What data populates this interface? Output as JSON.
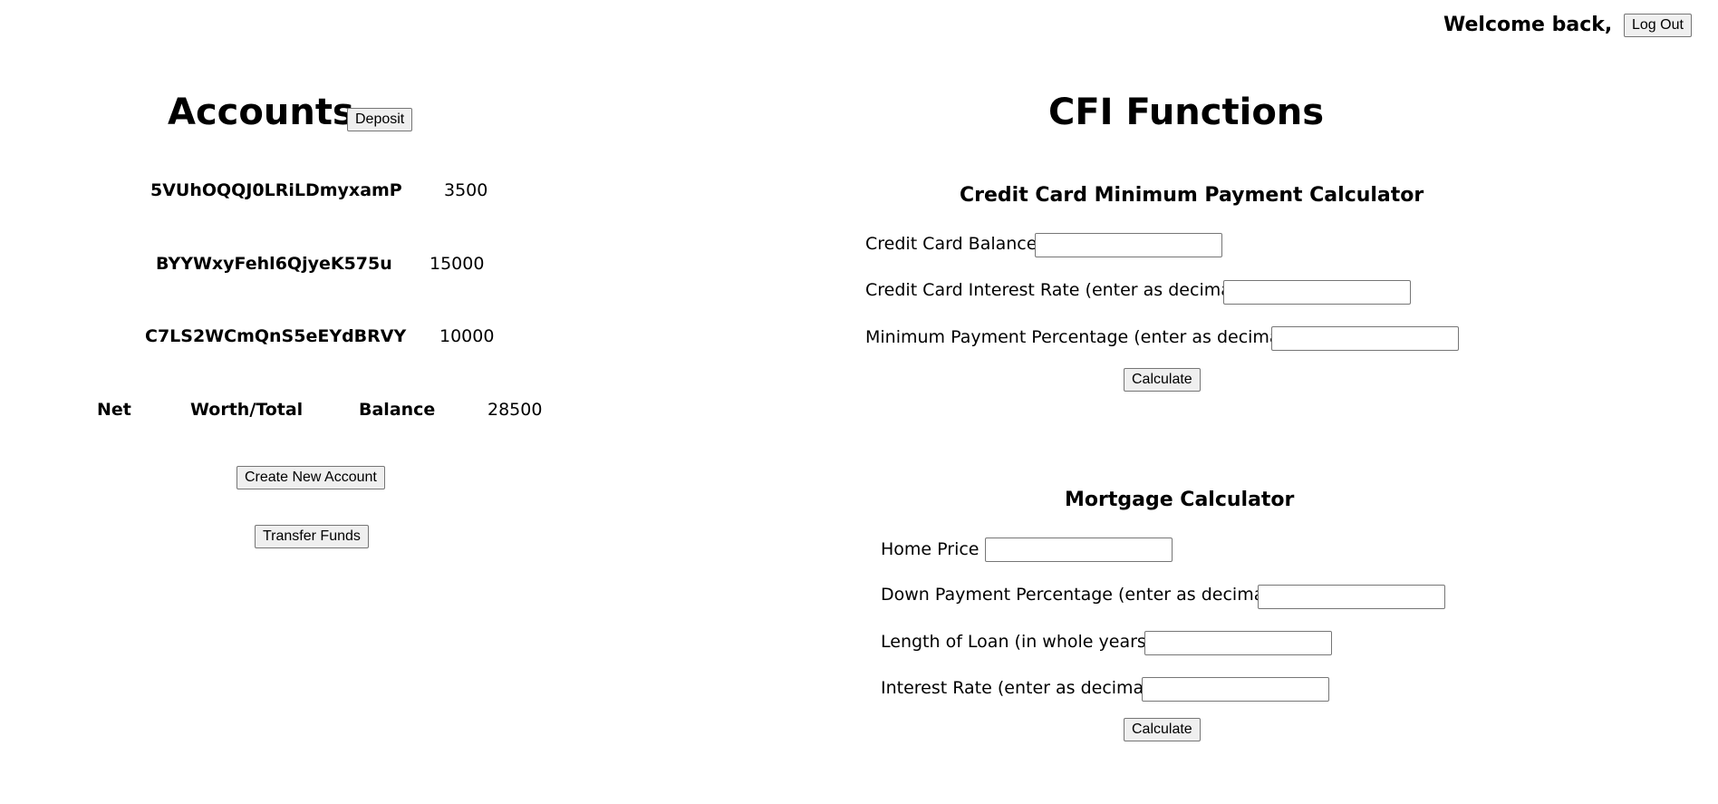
{
  "header": {
    "welcome_text": "Welcome back,",
    "logout_label": "Log Out"
  },
  "accounts": {
    "title": "Accounts",
    "deposit_label": "Deposit",
    "items": [
      {
        "id": "5VUhOQQJ0LRiLDmyxamP",
        "balance": "3500"
      },
      {
        "id": "BYYWxyFehl6QjyeK575u",
        "balance": "15000"
      },
      {
        "id": "C7LS2WCmQnS5eEYdBRVY",
        "balance": "10000"
      }
    ],
    "net_worth": {
      "word1": "Net",
      "word2": "Worth/Total",
      "word3": "Balance",
      "value": "28500"
    },
    "create_label": "Create New Account",
    "transfer_label": "Transfer Funds"
  },
  "cfi": {
    "title": "CFI Functions",
    "credit_card": {
      "title": "Credit Card Minimum Payment Calculator",
      "balance_label": "Credit Card Balance",
      "balance_value": "",
      "rate_label": "Credit Card Interest Rate (enter as decimal)",
      "rate_value": "",
      "min_pct_label": "Minimum Payment Percentage (enter as decimal)",
      "min_pct_value": "",
      "calculate_label": "Calculate"
    },
    "mortgage": {
      "title": "Mortgage Calculator",
      "home_price_label": "Home Price",
      "home_price_value": "",
      "down_pct_label": "Down Payment Percentage (enter as decimal)",
      "down_pct_value": "",
      "length_label": "Length of Loan (in whole years)",
      "length_value": "",
      "rate_label": "Interest Rate (enter as decimal)",
      "rate_value": "",
      "calculate_label": "Calculate"
    }
  }
}
